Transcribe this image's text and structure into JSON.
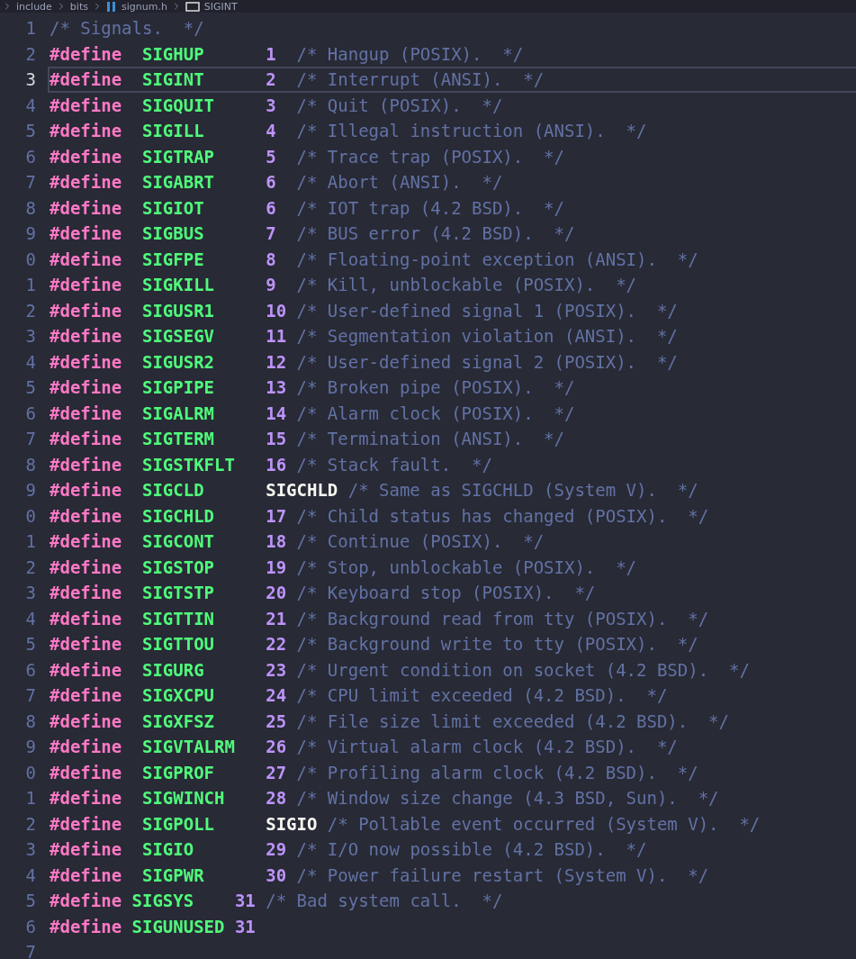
{
  "breadcrumb": [
    {
      "kind": "folder",
      "label": "include"
    },
    {
      "kind": "folder",
      "label": "bits"
    },
    {
      "kind": "file",
      "label": "signum.h"
    },
    {
      "kind": "symbol",
      "label": "SIGINT"
    }
  ],
  "editor": {
    "lines": [
      {
        "number": "1",
        "current": false,
        "kind": "comment",
        "tokens": [
          {
            "kind": "comment",
            "text": "/* Signals.  */"
          }
        ]
      },
      {
        "number": "2",
        "current": false,
        "kind": "define",
        "tokens": [
          {
            "kind": "directive",
            "text": "#define"
          },
          {
            "kind": "macro",
            "text": "SIGHUP"
          },
          {
            "kind": "number",
            "text": "1"
          },
          {
            "kind": "comment",
            "text": "/* Hangup (POSIX).  */"
          }
        ]
      },
      {
        "number": "3",
        "current": true,
        "kind": "define",
        "tokens": [
          {
            "kind": "directive",
            "text": "#define"
          },
          {
            "kind": "macro",
            "text": "SIGINT"
          },
          {
            "kind": "number",
            "text": "2"
          },
          {
            "kind": "comment",
            "text": "/* Interrupt (ANSI).  */"
          }
        ]
      },
      {
        "number": "4",
        "current": false,
        "kind": "define",
        "tokens": [
          {
            "kind": "directive",
            "text": "#define"
          },
          {
            "kind": "macro",
            "text": "SIGQUIT"
          },
          {
            "kind": "number",
            "text": "3"
          },
          {
            "kind": "comment",
            "text": "/* Quit (POSIX).  */"
          }
        ]
      },
      {
        "number": "5",
        "current": false,
        "kind": "define",
        "tokens": [
          {
            "kind": "directive",
            "text": "#define"
          },
          {
            "kind": "macro",
            "text": "SIGILL"
          },
          {
            "kind": "number",
            "text": "4"
          },
          {
            "kind": "comment",
            "text": "/* Illegal instruction (ANSI).  */"
          }
        ]
      },
      {
        "number": "6",
        "current": false,
        "kind": "define",
        "tokens": [
          {
            "kind": "directive",
            "text": "#define"
          },
          {
            "kind": "macro",
            "text": "SIGTRAP"
          },
          {
            "kind": "number",
            "text": "5"
          },
          {
            "kind": "comment",
            "text": "/* Trace trap (POSIX).  */"
          }
        ]
      },
      {
        "number": "7",
        "current": false,
        "kind": "define",
        "tokens": [
          {
            "kind": "directive",
            "text": "#define"
          },
          {
            "kind": "macro",
            "text": "SIGABRT"
          },
          {
            "kind": "number",
            "text": "6"
          },
          {
            "kind": "comment",
            "text": "/* Abort (ANSI).  */"
          }
        ]
      },
      {
        "number": "8",
        "current": false,
        "kind": "define",
        "tokens": [
          {
            "kind": "directive",
            "text": "#define"
          },
          {
            "kind": "macro",
            "text": "SIGIOT"
          },
          {
            "kind": "number",
            "text": "6"
          },
          {
            "kind": "comment",
            "text": "/* IOT trap (4.2 BSD).  */"
          }
        ]
      },
      {
        "number": "9",
        "current": false,
        "kind": "define",
        "tokens": [
          {
            "kind": "directive",
            "text": "#define"
          },
          {
            "kind": "macro",
            "text": "SIGBUS"
          },
          {
            "kind": "number",
            "text": "7"
          },
          {
            "kind": "comment",
            "text": "/* BUS error (4.2 BSD).  */"
          }
        ]
      },
      {
        "number": "0",
        "current": false,
        "kind": "define",
        "tokens": [
          {
            "kind": "directive",
            "text": "#define"
          },
          {
            "kind": "macro",
            "text": "SIGFPE"
          },
          {
            "kind": "number",
            "text": "8"
          },
          {
            "kind": "comment",
            "text": "/* Floating-point exception (ANSI).  */"
          }
        ]
      },
      {
        "number": "1",
        "current": false,
        "kind": "define",
        "tokens": [
          {
            "kind": "directive",
            "text": "#define"
          },
          {
            "kind": "macro",
            "text": "SIGKILL"
          },
          {
            "kind": "number",
            "text": "9"
          },
          {
            "kind": "comment",
            "text": "/* Kill, unblockable (POSIX).  */"
          }
        ]
      },
      {
        "number": "2",
        "current": false,
        "kind": "define",
        "tokens": [
          {
            "kind": "directive",
            "text": "#define"
          },
          {
            "kind": "macro",
            "text": "SIGUSR1"
          },
          {
            "kind": "number",
            "text": "10"
          },
          {
            "kind": "comment",
            "text": "/* User-defined signal 1 (POSIX).  */"
          }
        ]
      },
      {
        "number": "3",
        "current": false,
        "kind": "define",
        "tokens": [
          {
            "kind": "directive",
            "text": "#define"
          },
          {
            "kind": "macro",
            "text": "SIGSEGV"
          },
          {
            "kind": "number",
            "text": "11"
          },
          {
            "kind": "comment",
            "text": "/* Segmentation violation (ANSI).  */"
          }
        ]
      },
      {
        "number": "4",
        "current": false,
        "kind": "define",
        "tokens": [
          {
            "kind": "directive",
            "text": "#define"
          },
          {
            "kind": "macro",
            "text": "SIGUSR2"
          },
          {
            "kind": "number",
            "text": "12"
          },
          {
            "kind": "comment",
            "text": "/* User-defined signal 2 (POSIX).  */"
          }
        ]
      },
      {
        "number": "5",
        "current": false,
        "kind": "define",
        "tokens": [
          {
            "kind": "directive",
            "text": "#define"
          },
          {
            "kind": "macro",
            "text": "SIGPIPE"
          },
          {
            "kind": "number",
            "text": "13"
          },
          {
            "kind": "comment",
            "text": "/* Broken pipe (POSIX).  */"
          }
        ]
      },
      {
        "number": "6",
        "current": false,
        "kind": "define",
        "tokens": [
          {
            "kind": "directive",
            "text": "#define"
          },
          {
            "kind": "macro",
            "text": "SIGALRM"
          },
          {
            "kind": "number",
            "text": "14"
          },
          {
            "kind": "comment",
            "text": "/* Alarm clock (POSIX).  */"
          }
        ]
      },
      {
        "number": "7",
        "current": false,
        "kind": "define",
        "tokens": [
          {
            "kind": "directive",
            "text": "#define"
          },
          {
            "kind": "macro",
            "text": "SIGTERM"
          },
          {
            "kind": "number",
            "text": "15"
          },
          {
            "kind": "comment",
            "text": "/* Termination (ANSI).  */"
          }
        ]
      },
      {
        "number": "8",
        "current": false,
        "kind": "define",
        "tokens": [
          {
            "kind": "directive",
            "text": "#define"
          },
          {
            "kind": "macro",
            "text": "SIGSTKFLT"
          },
          {
            "kind": "number",
            "text": "16"
          },
          {
            "kind": "comment",
            "text": "/* Stack fault.  */"
          }
        ]
      },
      {
        "number": "9",
        "current": false,
        "kind": "define",
        "tokens": [
          {
            "kind": "directive",
            "text": "#define"
          },
          {
            "kind": "macro",
            "text": "SIGCLD"
          },
          {
            "kind": "identifier",
            "text": "SIGCHLD"
          },
          {
            "kind": "comment",
            "text": "/* Same as SIGCHLD (System V).  */"
          }
        ]
      },
      {
        "number": "0",
        "current": false,
        "kind": "define",
        "tokens": [
          {
            "kind": "directive",
            "text": "#define"
          },
          {
            "kind": "macro",
            "text": "SIGCHLD"
          },
          {
            "kind": "number",
            "text": "17"
          },
          {
            "kind": "comment",
            "text": "/* Child status has changed (POSIX).  */"
          }
        ]
      },
      {
        "number": "1",
        "current": false,
        "kind": "define",
        "tokens": [
          {
            "kind": "directive",
            "text": "#define"
          },
          {
            "kind": "macro",
            "text": "SIGCONT"
          },
          {
            "kind": "number",
            "text": "18"
          },
          {
            "kind": "comment",
            "text": "/* Continue (POSIX).  */"
          }
        ]
      },
      {
        "number": "2",
        "current": false,
        "kind": "define",
        "tokens": [
          {
            "kind": "directive",
            "text": "#define"
          },
          {
            "kind": "macro",
            "text": "SIGSTOP"
          },
          {
            "kind": "number",
            "text": "19"
          },
          {
            "kind": "comment",
            "text": "/* Stop, unblockable (POSIX).  */"
          }
        ]
      },
      {
        "number": "3",
        "current": false,
        "kind": "define",
        "tokens": [
          {
            "kind": "directive",
            "text": "#define"
          },
          {
            "kind": "macro",
            "text": "SIGTSTP"
          },
          {
            "kind": "number",
            "text": "20"
          },
          {
            "kind": "comment",
            "text": "/* Keyboard stop (POSIX).  */"
          }
        ]
      },
      {
        "number": "4",
        "current": false,
        "kind": "define",
        "tokens": [
          {
            "kind": "directive",
            "text": "#define"
          },
          {
            "kind": "macro",
            "text": "SIGTTIN"
          },
          {
            "kind": "number",
            "text": "21"
          },
          {
            "kind": "comment",
            "text": "/* Background read from tty (POSIX).  */"
          }
        ]
      },
      {
        "number": "5",
        "current": false,
        "kind": "define",
        "tokens": [
          {
            "kind": "directive",
            "text": "#define"
          },
          {
            "kind": "macro",
            "text": "SIGTTOU"
          },
          {
            "kind": "number",
            "text": "22"
          },
          {
            "kind": "comment",
            "text": "/* Background write to tty (POSIX).  */"
          }
        ]
      },
      {
        "number": "6",
        "current": false,
        "kind": "define",
        "tokens": [
          {
            "kind": "directive",
            "text": "#define"
          },
          {
            "kind": "macro",
            "text": "SIGURG"
          },
          {
            "kind": "number",
            "text": "23"
          },
          {
            "kind": "comment",
            "text": "/* Urgent condition on socket (4.2 BSD).  */"
          }
        ]
      },
      {
        "number": "7",
        "current": false,
        "kind": "define",
        "tokens": [
          {
            "kind": "directive",
            "text": "#define"
          },
          {
            "kind": "macro",
            "text": "SIGXCPU"
          },
          {
            "kind": "number",
            "text": "24"
          },
          {
            "kind": "comment",
            "text": "/* CPU limit exceeded (4.2 BSD).  */"
          }
        ]
      },
      {
        "number": "8",
        "current": false,
        "kind": "define",
        "tokens": [
          {
            "kind": "directive",
            "text": "#define"
          },
          {
            "kind": "macro",
            "text": "SIGXFSZ"
          },
          {
            "kind": "number",
            "text": "25"
          },
          {
            "kind": "comment",
            "text": "/* File size limit exceeded (4.2 BSD).  */"
          }
        ]
      },
      {
        "number": "9",
        "current": false,
        "kind": "define",
        "tokens": [
          {
            "kind": "directive",
            "text": "#define"
          },
          {
            "kind": "macro",
            "text": "SIGVTALRM"
          },
          {
            "kind": "number",
            "text": "26"
          },
          {
            "kind": "comment",
            "text": "/* Virtual alarm clock (4.2 BSD).  */"
          }
        ]
      },
      {
        "number": "0",
        "current": false,
        "kind": "define",
        "tokens": [
          {
            "kind": "directive",
            "text": "#define"
          },
          {
            "kind": "macro",
            "text": "SIGPROF"
          },
          {
            "kind": "number",
            "text": "27"
          },
          {
            "kind": "comment",
            "text": "/* Profiling alarm clock (4.2 BSD).  */"
          }
        ]
      },
      {
        "number": "1",
        "current": false,
        "kind": "define",
        "tokens": [
          {
            "kind": "directive",
            "text": "#define"
          },
          {
            "kind": "macro",
            "text": "SIGWINCH"
          },
          {
            "kind": "number",
            "text": "28"
          },
          {
            "kind": "comment",
            "text": "/* Window size change (4.3 BSD, Sun).  */"
          }
        ]
      },
      {
        "number": "2",
        "current": false,
        "kind": "define",
        "tokens": [
          {
            "kind": "directive",
            "text": "#define"
          },
          {
            "kind": "macro",
            "text": "SIGPOLL"
          },
          {
            "kind": "identifier",
            "text": "SIGIO"
          },
          {
            "kind": "comment",
            "text": "/* Pollable event occurred (System V).  */"
          }
        ]
      },
      {
        "number": "3",
        "current": false,
        "kind": "define",
        "tokens": [
          {
            "kind": "directive",
            "text": "#define"
          },
          {
            "kind": "macro",
            "text": "SIGIO"
          },
          {
            "kind": "number",
            "text": "29"
          },
          {
            "kind": "comment",
            "text": "/* I/O now possible (4.2 BSD).  */"
          }
        ]
      },
      {
        "number": "4",
        "current": false,
        "kind": "define",
        "tokens": [
          {
            "kind": "directive",
            "text": "#define"
          },
          {
            "kind": "macro",
            "text": "SIGPWR"
          },
          {
            "kind": "number",
            "text": "30"
          },
          {
            "kind": "comment",
            "text": "/* Power failure restart (System V).  */"
          }
        ]
      },
      {
        "number": "5",
        "current": false,
        "kind": "define_tight",
        "tokens": [
          {
            "kind": "directive",
            "text": "#define"
          },
          {
            "kind": "macro",
            "text": "SIGSYS"
          },
          {
            "kind": "number",
            "text": "31"
          },
          {
            "kind": "comment",
            "text": "/* Bad system call.  */"
          }
        ]
      },
      {
        "number": "6",
        "current": false,
        "kind": "define_tight",
        "tokens": [
          {
            "kind": "directive",
            "text": "#define"
          },
          {
            "kind": "macro",
            "text": "SIGUNUSED"
          },
          {
            "kind": "number",
            "text": "31"
          }
        ]
      },
      {
        "number": "7",
        "current": false,
        "kind": "blank"
      }
    ]
  }
}
